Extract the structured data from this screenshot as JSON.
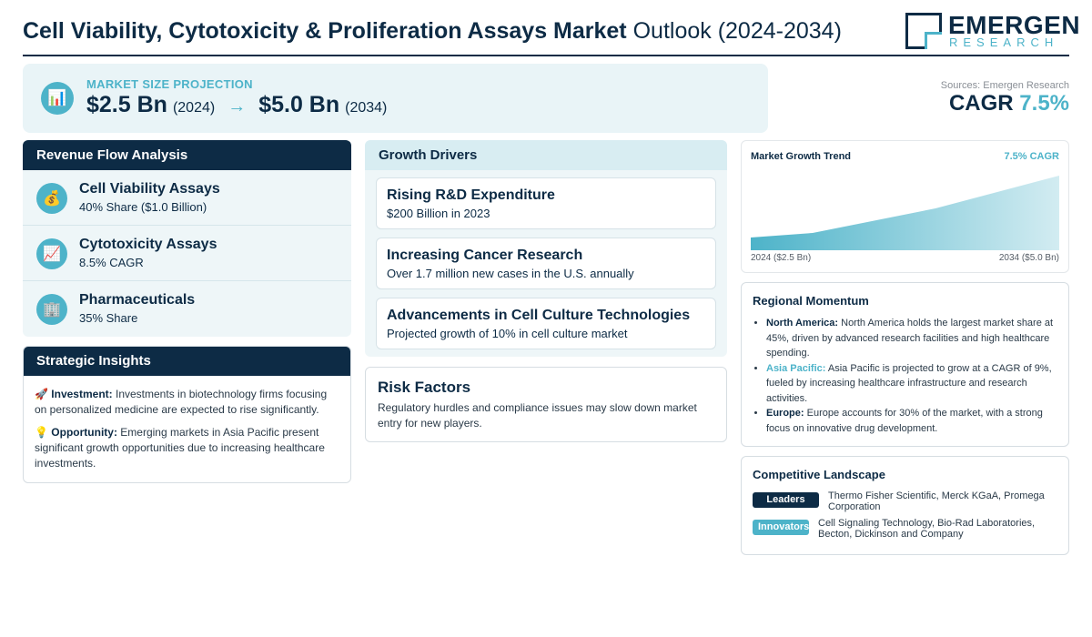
{
  "header": {
    "title_bold": "Cell Viability, Cytotoxicity & Proliferation Assays Market",
    "title_light": "Outlook (2024-2034)",
    "logo_word": "EMERGEN",
    "logo_sub": "RESEARCH"
  },
  "projection": {
    "label": "MARKET SIZE PROJECTION",
    "icon": "bar-chart-icon",
    "start_value": "$2.5 Bn",
    "start_year": "(2024)",
    "arrow": "→",
    "end_value": "$5.0 Bn",
    "end_year": "(2034)"
  },
  "sources": "Sources: Emergen Research",
  "cagr": {
    "label": "CAGR",
    "value": "7.5%"
  },
  "revenue": {
    "title": "Revenue Flow Analysis",
    "items": [
      {
        "icon": "money-bag-icon",
        "glyph": "💰",
        "title": "Cell Viability Assays",
        "sub": "40% Share ($1.0 Billion)"
      },
      {
        "icon": "trend-up-icon",
        "glyph": "📈",
        "title": "Cytotoxicity Assays",
        "sub": "8.5% CAGR"
      },
      {
        "icon": "building-icon",
        "glyph": "🏢",
        "title": "Pharmaceuticals",
        "sub": "35% Share"
      }
    ]
  },
  "strategic": {
    "title": "Strategic Insights",
    "items": [
      {
        "glyph": "🚀",
        "label": "Investment:",
        "text": "Investments in biotechnology firms focusing on personalized medicine are expected to rise significantly."
      },
      {
        "glyph": "💡",
        "label": "Opportunity:",
        "text": "Emerging markets in Asia Pacific present significant growth opportunities due to increasing healthcare investments."
      }
    ]
  },
  "drivers": {
    "title": "Growth Drivers",
    "items": [
      {
        "title": "Rising R&D Expenditure",
        "sub": "$200 Billion in 2023"
      },
      {
        "title": "Increasing Cancer Research",
        "sub": "Over 1.7 million new cases in the U.S. annually"
      },
      {
        "title": "Advancements in Cell Culture Technologies",
        "sub": "Projected growth of 10% in cell culture market"
      }
    ]
  },
  "risk": {
    "title": "Risk Factors",
    "text": "Regulatory hurdles and compliance issues may slow down market entry for new players."
  },
  "trend": {
    "title": "Market Growth Trend",
    "cagr": "7.5% CAGR",
    "start_label": "2024 ($2.5 Bn)",
    "end_label": "2034 ($5.0 Bn)",
    "accent": "#4db3c9"
  },
  "regional": {
    "title": "Regional Momentum",
    "items": [
      {
        "label": "North America:",
        "text": "North America holds the largest market share at 45%, driven by advanced research facilities and high healthcare spending."
      },
      {
        "label": "Asia Pacific:",
        "text": "Asia Pacific is projected to grow at a CAGR of 9%, fueled by increasing healthcare infrastructure and research activities."
      },
      {
        "label": "Europe:",
        "text": "Europe accounts for 30% of the market, with a strong focus on innovative drug development."
      }
    ]
  },
  "competitive": {
    "title": "Competitive Landscape",
    "rows": [
      {
        "badge": "Leaders",
        "text": "Thermo Fisher Scientific, Merck KGaA, Promega Corporation"
      },
      {
        "badge": "Innovators",
        "text": "Cell Signaling Technology, Bio-Rad Laboratories, Becton, Dickinson and Company"
      }
    ]
  },
  "colors": {
    "navy": "#0d2b45",
    "teal": "#4db3c9",
    "panel": "#eef6f8"
  }
}
